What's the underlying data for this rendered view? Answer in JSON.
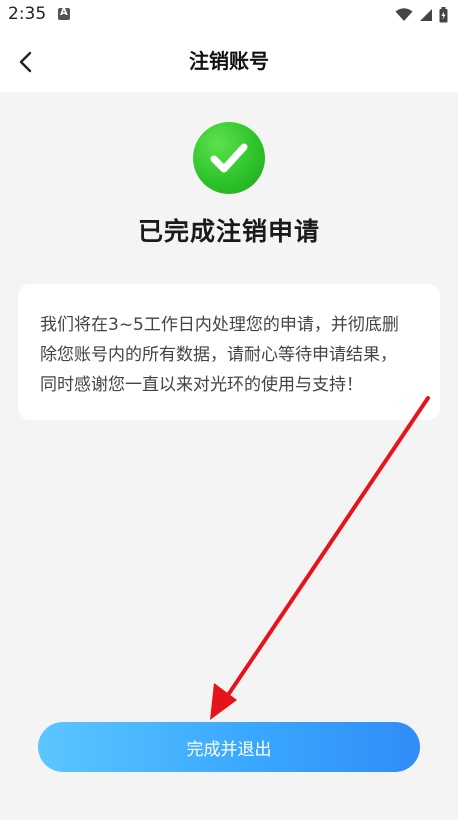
{
  "status_bar": {
    "time": "2:35",
    "icons": [
      "a-notification-icon",
      "wifi-icon",
      "signal-icon",
      "battery-icon"
    ]
  },
  "header": {
    "title": "注销账号",
    "back_icon": "chevron-left-icon"
  },
  "result": {
    "icon": "check-circle-icon",
    "title": "已完成注销申请",
    "message_lines": [
      "我们将在3~5工作日内处理您的申请，并彻底删",
      "除您账号内的所有数据，请耐心等待申请结果，",
      "同时感谢您一直以来对光环的使用与支持！"
    ]
  },
  "action": {
    "finish_label": "完成并退出"
  },
  "colors": {
    "success_green": "#2fc32a",
    "button_start": "#5bc6ff",
    "button_end": "#2f8df7",
    "annotation_red": "#e6141a"
  }
}
